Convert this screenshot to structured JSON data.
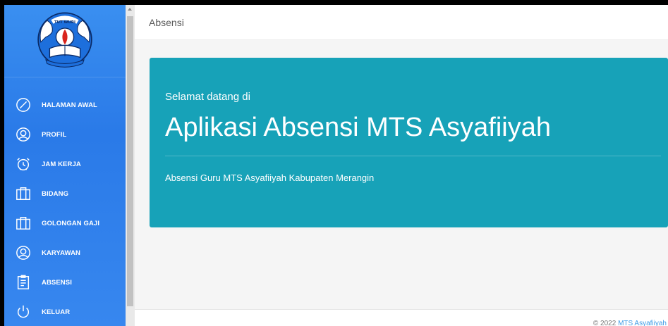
{
  "sidebar": {
    "logo_icon": "tut-wuri-handayani-logo",
    "items": [
      {
        "label": "HALAMAN AWAL",
        "icon": "dashboard-gauge-icon"
      },
      {
        "label": "PROFIL",
        "icon": "user-icon"
      },
      {
        "label": "JAM KERJA",
        "icon": "alarm-clock-icon"
      },
      {
        "label": "BIDANG",
        "icon": "briefcase-icon"
      },
      {
        "label": "GOLONGAN GAJI",
        "icon": "briefcase-icon"
      },
      {
        "label": "KARYAWAN",
        "icon": "user-icon"
      },
      {
        "label": "ABSENSI",
        "icon": "clipboard-icon"
      },
      {
        "label": "KELUAR",
        "icon": "power-icon"
      }
    ]
  },
  "header": {
    "title": "Absensi"
  },
  "hero": {
    "greeting": "Selamat datang di",
    "title": "Aplikasi Absensi MTS Asyafiiyah",
    "subtitle": "Absensi Guru MTS Asyafiiyah Kabupaten Merangin"
  },
  "footer": {
    "copyright": "© 2022 ",
    "link_text": "MTS Asyafiiyah"
  },
  "colors": {
    "sidebar": "#2a7ae8",
    "hero": "#17a2b8",
    "link": "#3c9be6"
  }
}
